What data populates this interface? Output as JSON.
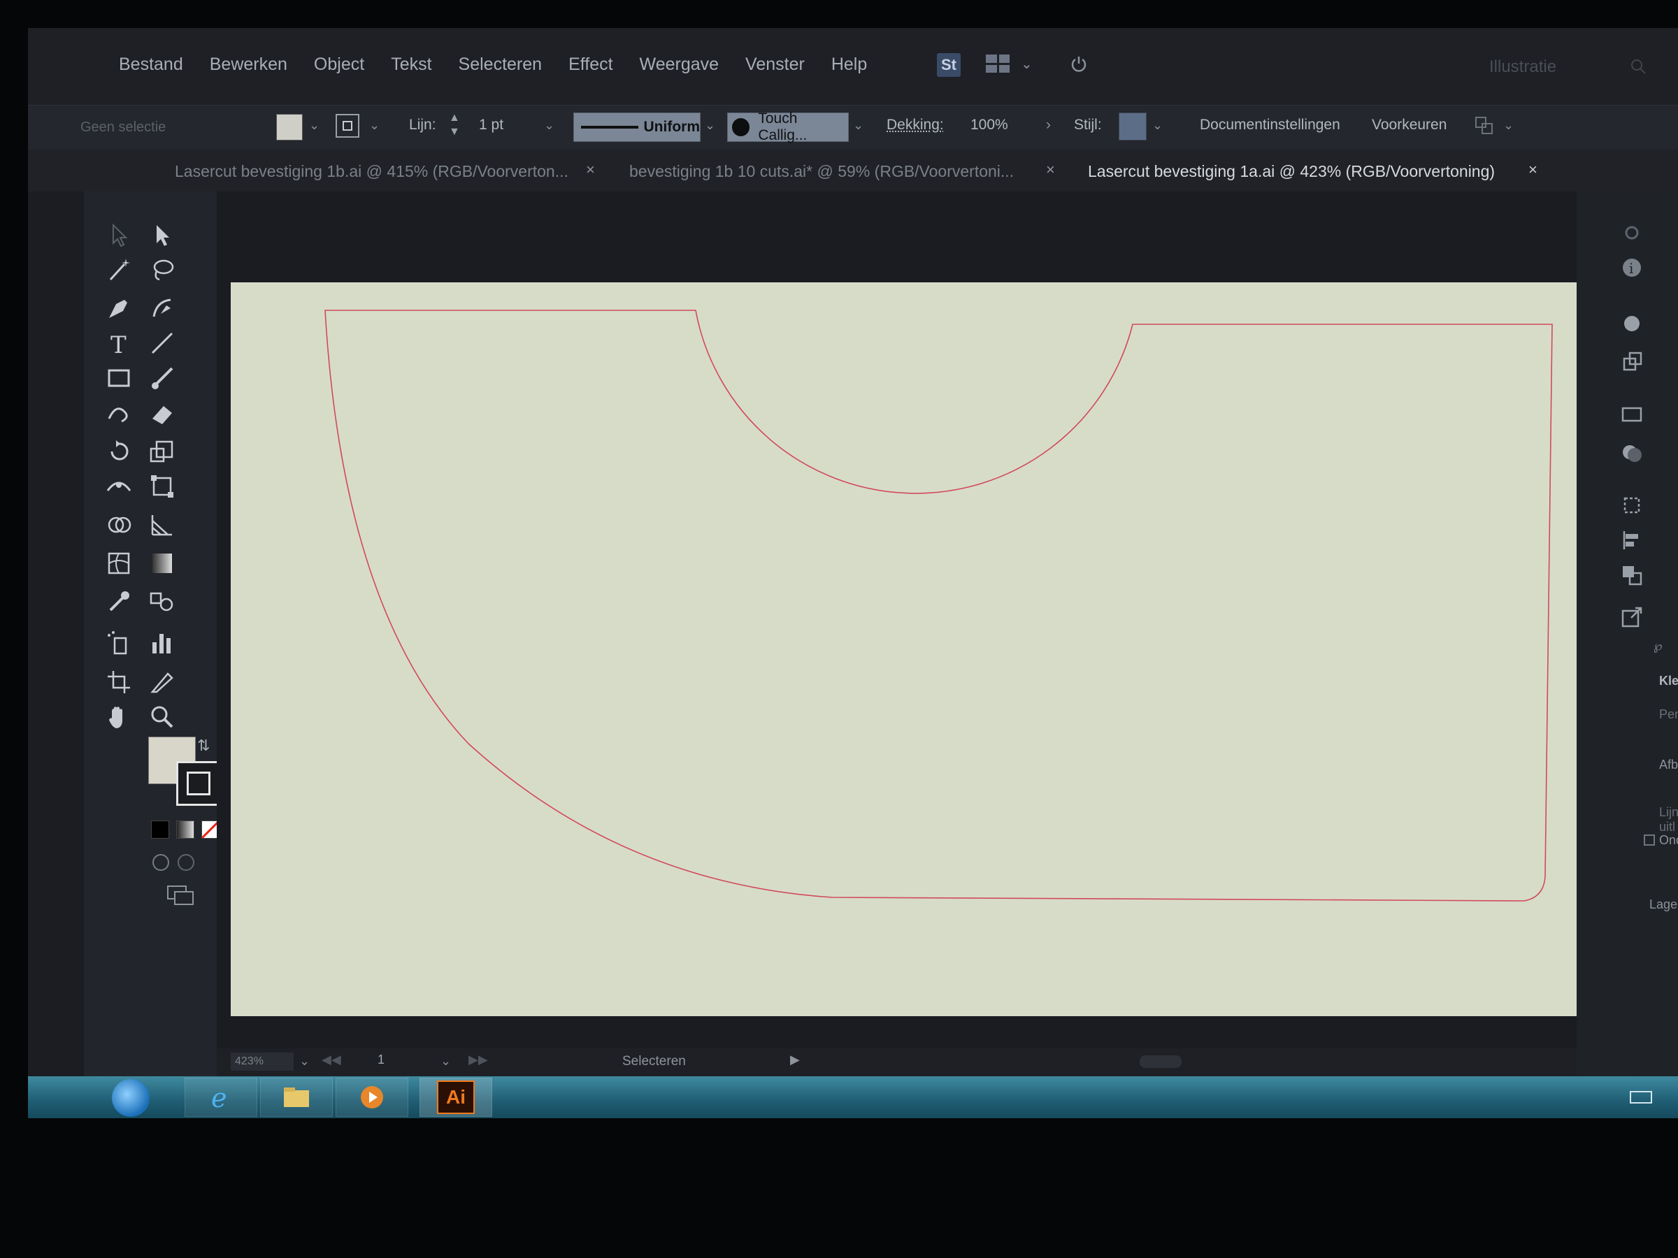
{
  "menu": {
    "items": [
      "Bestand",
      "Bewerken",
      "Object",
      "Tekst",
      "Selecteren",
      "Effect",
      "Weergave",
      "Venster",
      "Help"
    ],
    "st_badge": "St",
    "workspace": "Illustratie"
  },
  "control": {
    "selection": "Geen selectie",
    "stroke_label": "Lijn:",
    "stroke_weight": "1 pt",
    "profile": "Uniform",
    "brush": "Touch Callig...",
    "opacity_label": "Dekking:",
    "opacity_value": "100%",
    "style_label": "Stijl:",
    "doc_settings": "Documentinstellingen",
    "preferences": "Voorkeuren",
    "fill_color": "#cfcfc8",
    "style_color": "#5c6d88"
  },
  "tabs": [
    {
      "label": "Lasercut bevestiging 1b.ai @ 415% (RGB/Voorverton...",
      "active": false
    },
    {
      "label": "bevestiging 1b 10 cuts.ai* @ 59% (RGB/Voorvertoni...",
      "active": false
    },
    {
      "label": "Lasercut bevestiging 1a.ai @ 423% (RGB/Voorvertoning)",
      "active": true
    }
  ],
  "tab_close": "×",
  "status": {
    "zoom": "423%",
    "artboard": "1",
    "tool": "Selecteren"
  },
  "right_panel": {
    "labels": [
      "Kle",
      "Pens",
      "Afbak",
      "Lijn uitl",
      "Ond",
      "Lagen"
    ]
  },
  "colors": {
    "artboard": "#d7dcc9",
    "cut_line": "#d14a5a",
    "ai_orange": "#f07a1d"
  },
  "taskbar": {
    "apps": [
      "internet-explorer",
      "file-explorer",
      "media-player",
      "adobe-illustrator"
    ],
    "ai_label": "Ai"
  }
}
